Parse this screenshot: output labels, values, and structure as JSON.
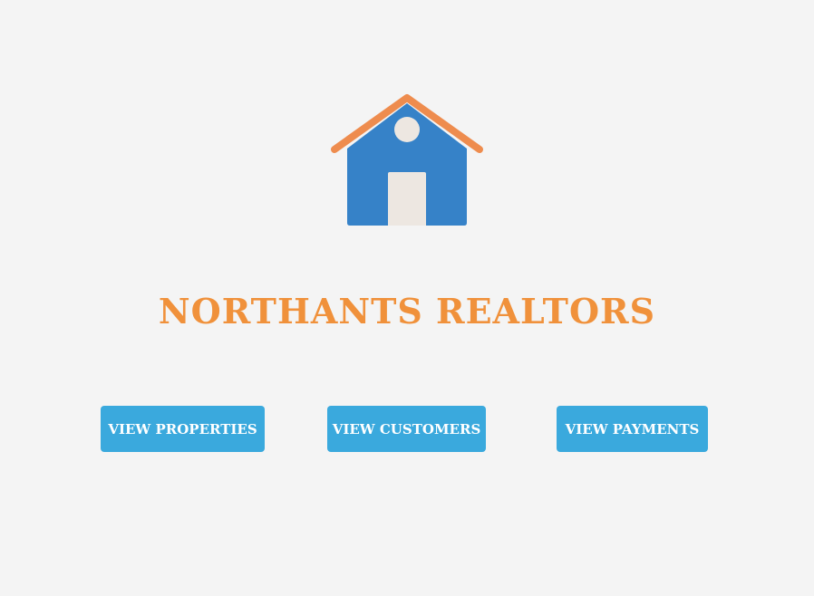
{
  "brand": {
    "title": "NORTHANTS REALTORS",
    "logo_icon": "house-icon",
    "colors": {
      "title": "#f0913b",
      "roof": "#ee8c4e",
      "house": "#3682c8",
      "door": "#ede7e1",
      "button": "#3aa9dd",
      "background": "#f4f4f4"
    }
  },
  "nav": {
    "properties_label": "VIEW PROPERTIES",
    "customers_label": "VIEW CUSTOMERS",
    "payments_label": "VIEW PAYMENTS"
  }
}
